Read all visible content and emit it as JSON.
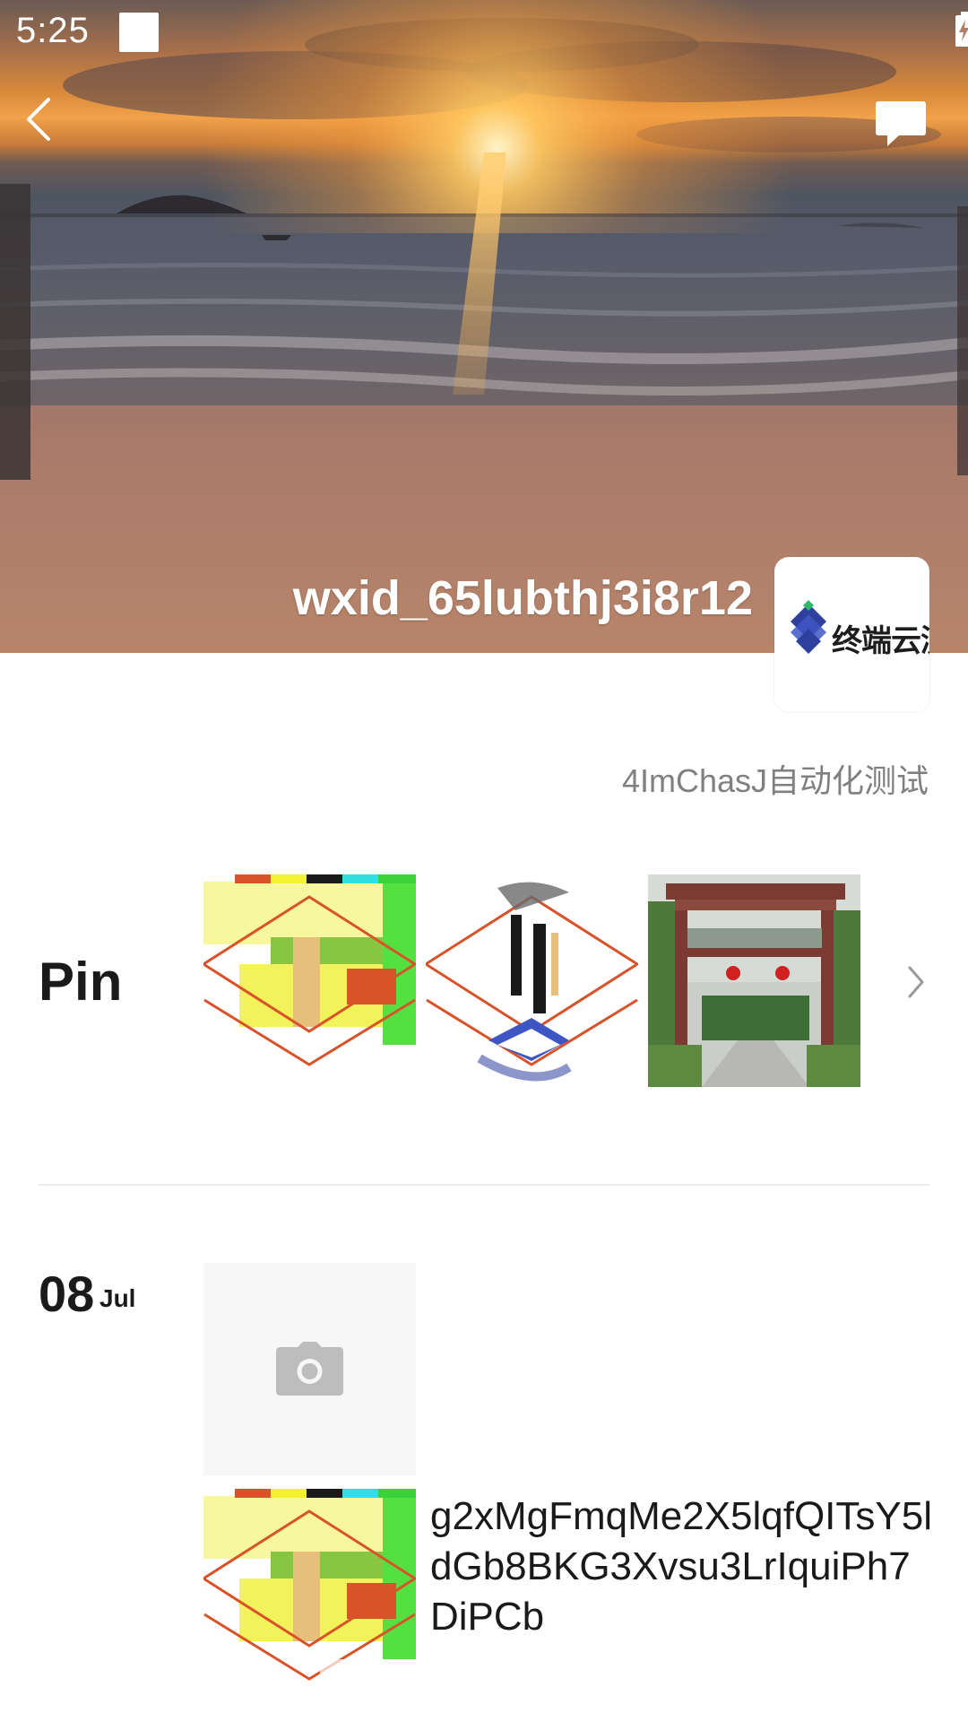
{
  "status_bar": {
    "time": "5:25"
  },
  "header": {
    "back_icon": "chevron-left-icon",
    "comments_icon": "comment-bubble-icon"
  },
  "profile": {
    "username": "wxid_65lubthj3i8r12",
    "avatar_text": "终端云测",
    "signature": "4ImChasJ自动化测试"
  },
  "pinned": {
    "label": "Pin",
    "thumbnails": [
      "pinned-photo-1",
      "pinned-photo-2",
      "pinned-photo-3"
    ],
    "more_icon": "chevron-right-icon"
  },
  "timeline": {
    "day": "08",
    "month": "Jul",
    "posts": [
      {
        "type": "photo-placeholder",
        "icon": "camera-icon"
      },
      {
        "type": "photo-with-text",
        "text": "g2xMgFmqMe2X5lqfQITsY5ldGb8BKG3Xvsu3LrIquiPh7DiPCb",
        "icon": "upload-icon"
      }
    ]
  },
  "colors": {
    "accent_orange": "#d9532a",
    "divider": "#ececec",
    "secondary_text": "#808080",
    "logo_blue": "#2f3f9e"
  }
}
